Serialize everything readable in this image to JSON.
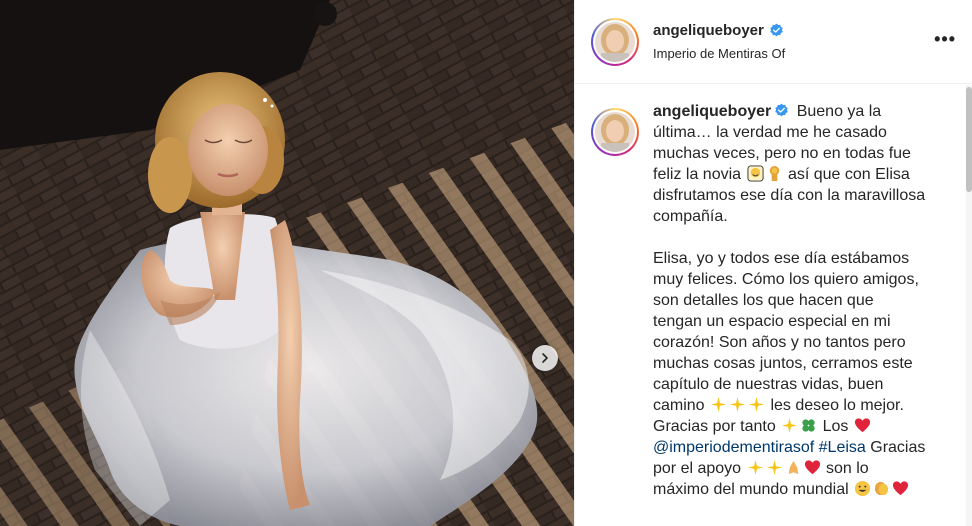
{
  "post": {
    "username": "angeliqueboyer",
    "location": "Imperio de Mentiras Of",
    "more_label": "•••",
    "caption": {
      "p1_line1_tail": " Bueno ya la",
      "p1_line2": "última… la verdad me he casado",
      "p1_line3": "muchas veces, pero no en todas fue",
      "p1_line4_a": "feliz la novia ",
      "p1_line4_b": " así que con Elisa",
      "p1_line5": "disfrutamos ese día con la maravillosa",
      "p1_line6": "compañía.",
      "p2_line1": "Elisa, yo y todos ese día estábamos",
      "p2_line2": "muy felices. Cómo los quiero amigos,",
      "p2_line3": "son detalles los que hacen que",
      "p2_line4": "tengan un espacio especial en mi",
      "p2_line5": "corazón! Son años y no tantos pero",
      "p2_line6": "muchas cosas juntos, cerramos este",
      "p2_line7": "capítulo de nuestras vidas, buen",
      "p2_line8_a": "camino ",
      "p2_line8_b": " les deseo lo mejor.",
      "p2_line9_a": "Gracias por tanto ",
      "p2_line9_b": " Los ",
      "mention": "@imperiodementirasof",
      "hashtag": "#Leisa",
      "p2_line10_tail": " Gracias",
      "p2_line11_a": "por el apoyo ",
      "p2_line11_b": " son lo",
      "p2_line12_a": "máximo del mundo mundial "
    }
  },
  "colors": {
    "verified": "#3897f0",
    "link": "#00376b",
    "text": "#262626"
  },
  "icons": [
    "verified-badge-icon",
    "more-options-icon",
    "chevron-right-icon"
  ]
}
